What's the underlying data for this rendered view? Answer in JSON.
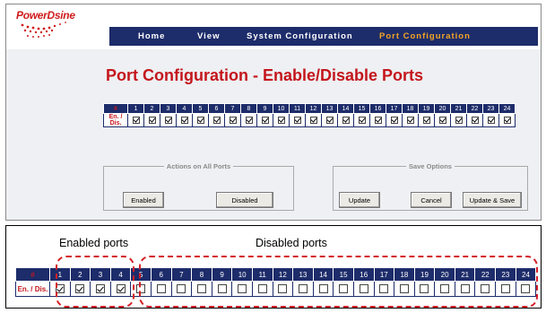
{
  "logo": {
    "text": "PowerDsine"
  },
  "nav": {
    "items": [
      {
        "label": "Home",
        "active": false
      },
      {
        "label": "View",
        "active": false
      },
      {
        "label": "System Configuration",
        "active": false
      },
      {
        "label": "Port Configuration",
        "active": true
      }
    ]
  },
  "page_title": "Port Configuration - Enable/Disable Ports",
  "port_table": {
    "hash_label": "#",
    "row_label": "En. / Dis.",
    "ports": [
      "1",
      "2",
      "3",
      "4",
      "5",
      "6",
      "7",
      "8",
      "9",
      "10",
      "11",
      "12",
      "13",
      "14",
      "15",
      "16",
      "17",
      "18",
      "19",
      "20",
      "21",
      "22",
      "23",
      "24"
    ],
    "enabled": [
      true,
      true,
      true,
      true,
      true,
      true,
      true,
      true,
      true,
      true,
      true,
      true,
      true,
      true,
      true,
      true,
      true,
      true,
      true,
      true,
      true,
      true,
      true,
      true
    ]
  },
  "actions_group": {
    "legend": "Actions on All Ports",
    "enabled_button": "Enabled",
    "disabled_button": "Disabled"
  },
  "save_group": {
    "legend": "Save Options",
    "update_button": "Update",
    "cancel_button": "Cancel",
    "update_save_button": "Update & Save"
  },
  "annotated": {
    "enabled_label": "Enabled ports",
    "disabled_label": "Disabled ports",
    "enabled": [
      true,
      true,
      true,
      true,
      false,
      false,
      false,
      false,
      false,
      false,
      false,
      false,
      false,
      false,
      false,
      false,
      false,
      false,
      false,
      false,
      false,
      false,
      false,
      false
    ]
  },
  "colors": {
    "navy": "#1d2c6a",
    "red": "#c4161c",
    "accent_orange": "#f5a623",
    "annotation_red": "#d41f26"
  }
}
